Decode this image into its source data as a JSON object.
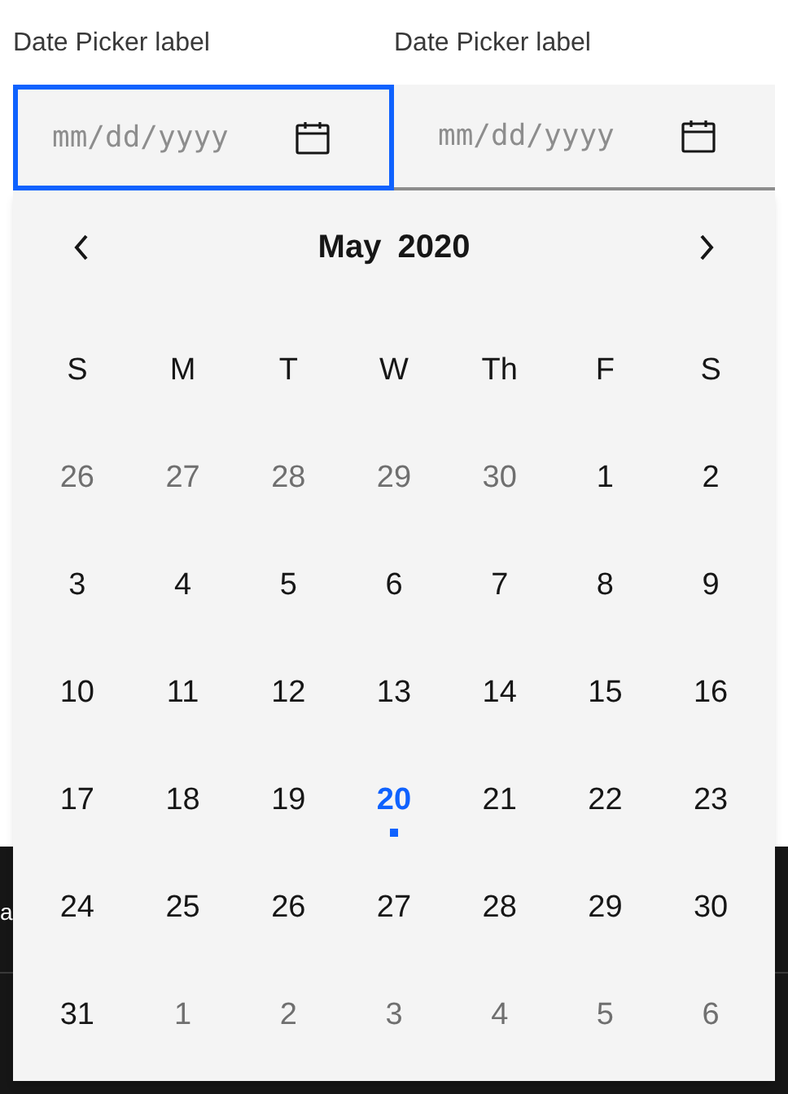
{
  "date_pickers": [
    {
      "label": "Date Picker label",
      "placeholder": "mm/dd/yyyy",
      "focused": true
    },
    {
      "label": "Date Picker label",
      "placeholder": "mm/dd/yyyy",
      "focused": false
    }
  ],
  "background_text": "a",
  "calendar": {
    "month": "May",
    "year": "2020",
    "weekdays": [
      "S",
      "M",
      "T",
      "W",
      "Th",
      "F",
      "S"
    ],
    "days": [
      {
        "text": "26",
        "outside": true,
        "today": false
      },
      {
        "text": "27",
        "outside": true,
        "today": false
      },
      {
        "text": "28",
        "outside": true,
        "today": false
      },
      {
        "text": "29",
        "outside": true,
        "today": false
      },
      {
        "text": "30",
        "outside": true,
        "today": false
      },
      {
        "text": "1",
        "outside": false,
        "today": false
      },
      {
        "text": "2",
        "outside": false,
        "today": false
      },
      {
        "text": "3",
        "outside": false,
        "today": false
      },
      {
        "text": "4",
        "outside": false,
        "today": false
      },
      {
        "text": "5",
        "outside": false,
        "today": false
      },
      {
        "text": "6",
        "outside": false,
        "today": false
      },
      {
        "text": "7",
        "outside": false,
        "today": false
      },
      {
        "text": "8",
        "outside": false,
        "today": false
      },
      {
        "text": "9",
        "outside": false,
        "today": false
      },
      {
        "text": "10",
        "outside": false,
        "today": false
      },
      {
        "text": "11",
        "outside": false,
        "today": false
      },
      {
        "text": "12",
        "outside": false,
        "today": false
      },
      {
        "text": "13",
        "outside": false,
        "today": false
      },
      {
        "text": "14",
        "outside": false,
        "today": false
      },
      {
        "text": "15",
        "outside": false,
        "today": false
      },
      {
        "text": "16",
        "outside": false,
        "today": false
      },
      {
        "text": "17",
        "outside": false,
        "today": false
      },
      {
        "text": "18",
        "outside": false,
        "today": false
      },
      {
        "text": "19",
        "outside": false,
        "today": false
      },
      {
        "text": "20",
        "outside": false,
        "today": true
      },
      {
        "text": "21",
        "outside": false,
        "today": false
      },
      {
        "text": "22",
        "outside": false,
        "today": false
      },
      {
        "text": "23",
        "outside": false,
        "today": false
      },
      {
        "text": "24",
        "outside": false,
        "today": false
      },
      {
        "text": "25",
        "outside": false,
        "today": false
      },
      {
        "text": "26",
        "outside": false,
        "today": false
      },
      {
        "text": "27",
        "outside": false,
        "today": false
      },
      {
        "text": "28",
        "outside": false,
        "today": false
      },
      {
        "text": "29",
        "outside": false,
        "today": false
      },
      {
        "text": "30",
        "outside": false,
        "today": false
      },
      {
        "text": "31",
        "outside": false,
        "today": false
      },
      {
        "text": "1",
        "outside": true,
        "today": false
      },
      {
        "text": "2",
        "outside": true,
        "today": false
      },
      {
        "text": "3",
        "outside": true,
        "today": false
      },
      {
        "text": "4",
        "outside": true,
        "today": false
      },
      {
        "text": "5",
        "outside": true,
        "today": false
      },
      {
        "text": "6",
        "outside": true,
        "today": false
      }
    ]
  }
}
